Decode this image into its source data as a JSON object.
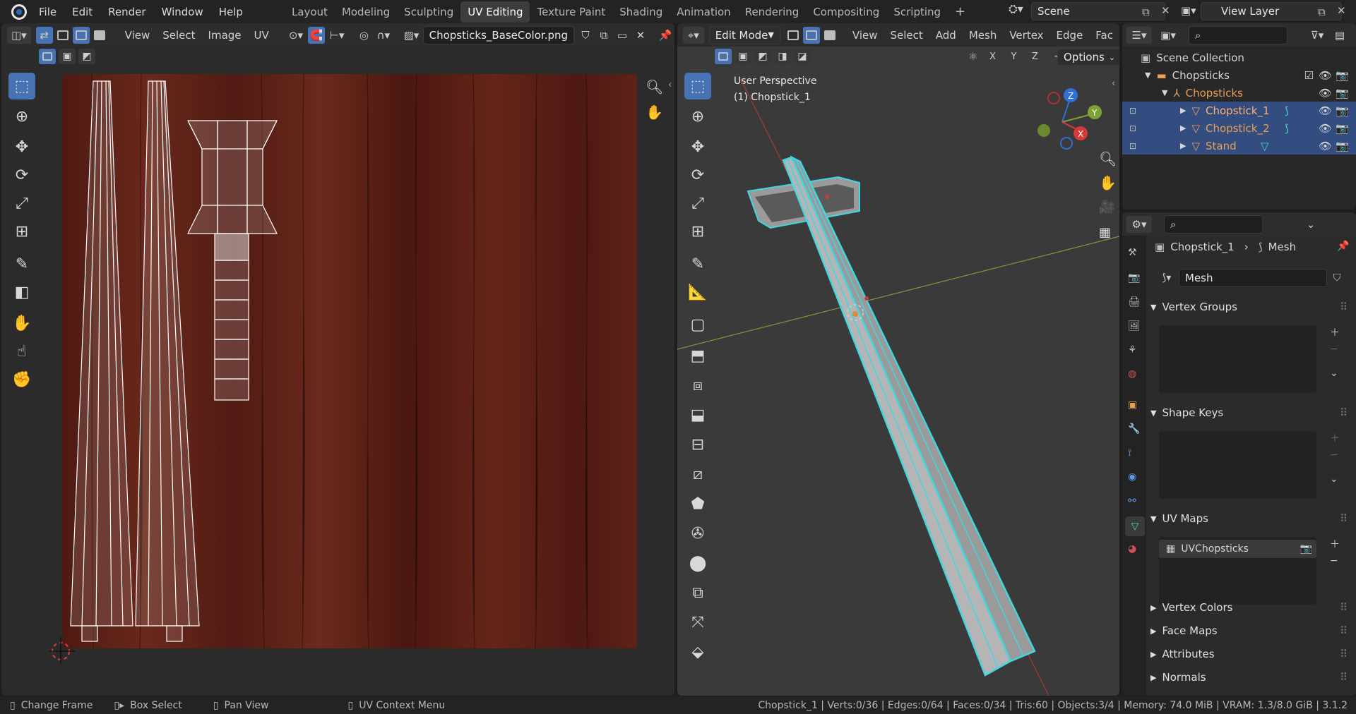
{
  "menu": [
    "File",
    "Edit",
    "Render",
    "Window",
    "Help"
  ],
  "workspaces": [
    "Layout",
    "Modeling",
    "Sculpting",
    "UV Editing",
    "Texture Paint",
    "Shading",
    "Animation",
    "Rendering",
    "Compositing",
    "Scripting"
  ],
  "active_workspace": "UV Editing",
  "scene": "Scene",
  "view_layer": "View Layer",
  "uv_editor": {
    "menus": [
      "View",
      "Select",
      "Image",
      "UV"
    ],
    "image_name": "Chopsticks_BaseColor.png"
  },
  "viewport": {
    "mode": "Edit Mode",
    "menus": [
      "View",
      "Select",
      "Add",
      "Mesh",
      "Vertex",
      "Edge",
      "Fac"
    ],
    "axes": [
      "X",
      "Y",
      "Z"
    ],
    "options": "Options",
    "overlay_title": "User Perspective",
    "overlay_object": "(1) Chopstick_1",
    "gizmo": {
      "z": "Z",
      "y": "Y",
      "x": "X"
    }
  },
  "outliner": {
    "scene_collection": "Scene Collection",
    "items": [
      {
        "name": "Chopsticks",
        "type": "collection"
      },
      {
        "name": "Chopsticks",
        "type": "empty"
      },
      {
        "name": "Chopstick_1",
        "type": "mesh",
        "active": true
      },
      {
        "name": "Chopstick_2",
        "type": "mesh"
      },
      {
        "name": "Stand",
        "type": "mesh"
      }
    ]
  },
  "properties": {
    "breadcrumb_object": "Chopstick_1",
    "breadcrumb_data": "Mesh",
    "mesh_name": "Mesh",
    "panels": {
      "vertex_groups": "Vertex Groups",
      "shape_keys": "Shape Keys",
      "uv_maps": "UV Maps",
      "uv_map_item": "UVChopsticks",
      "vertex_colors": "Vertex Colors",
      "face_maps": "Face Maps",
      "attributes": "Attributes",
      "normals": "Normals"
    }
  },
  "status_bar": {
    "left": [
      "Change Frame",
      "Box Select",
      "Pan View",
      "UV Context Menu"
    ],
    "stats": "Chopstick_1 | Verts:0/36 | Edges:0/64 | Faces:0/34 | Tris:60 | Objects:3/4 | Memory: 74.0 MiB | VRAM: 1.3/8.0 GiB | 3.1.2"
  },
  "colors": {
    "accent": "#4772b3",
    "selection": "#334d80",
    "mesh_edge": "#3fd7e0",
    "wood": "#5a2016",
    "orange_text": "#e0a060"
  }
}
